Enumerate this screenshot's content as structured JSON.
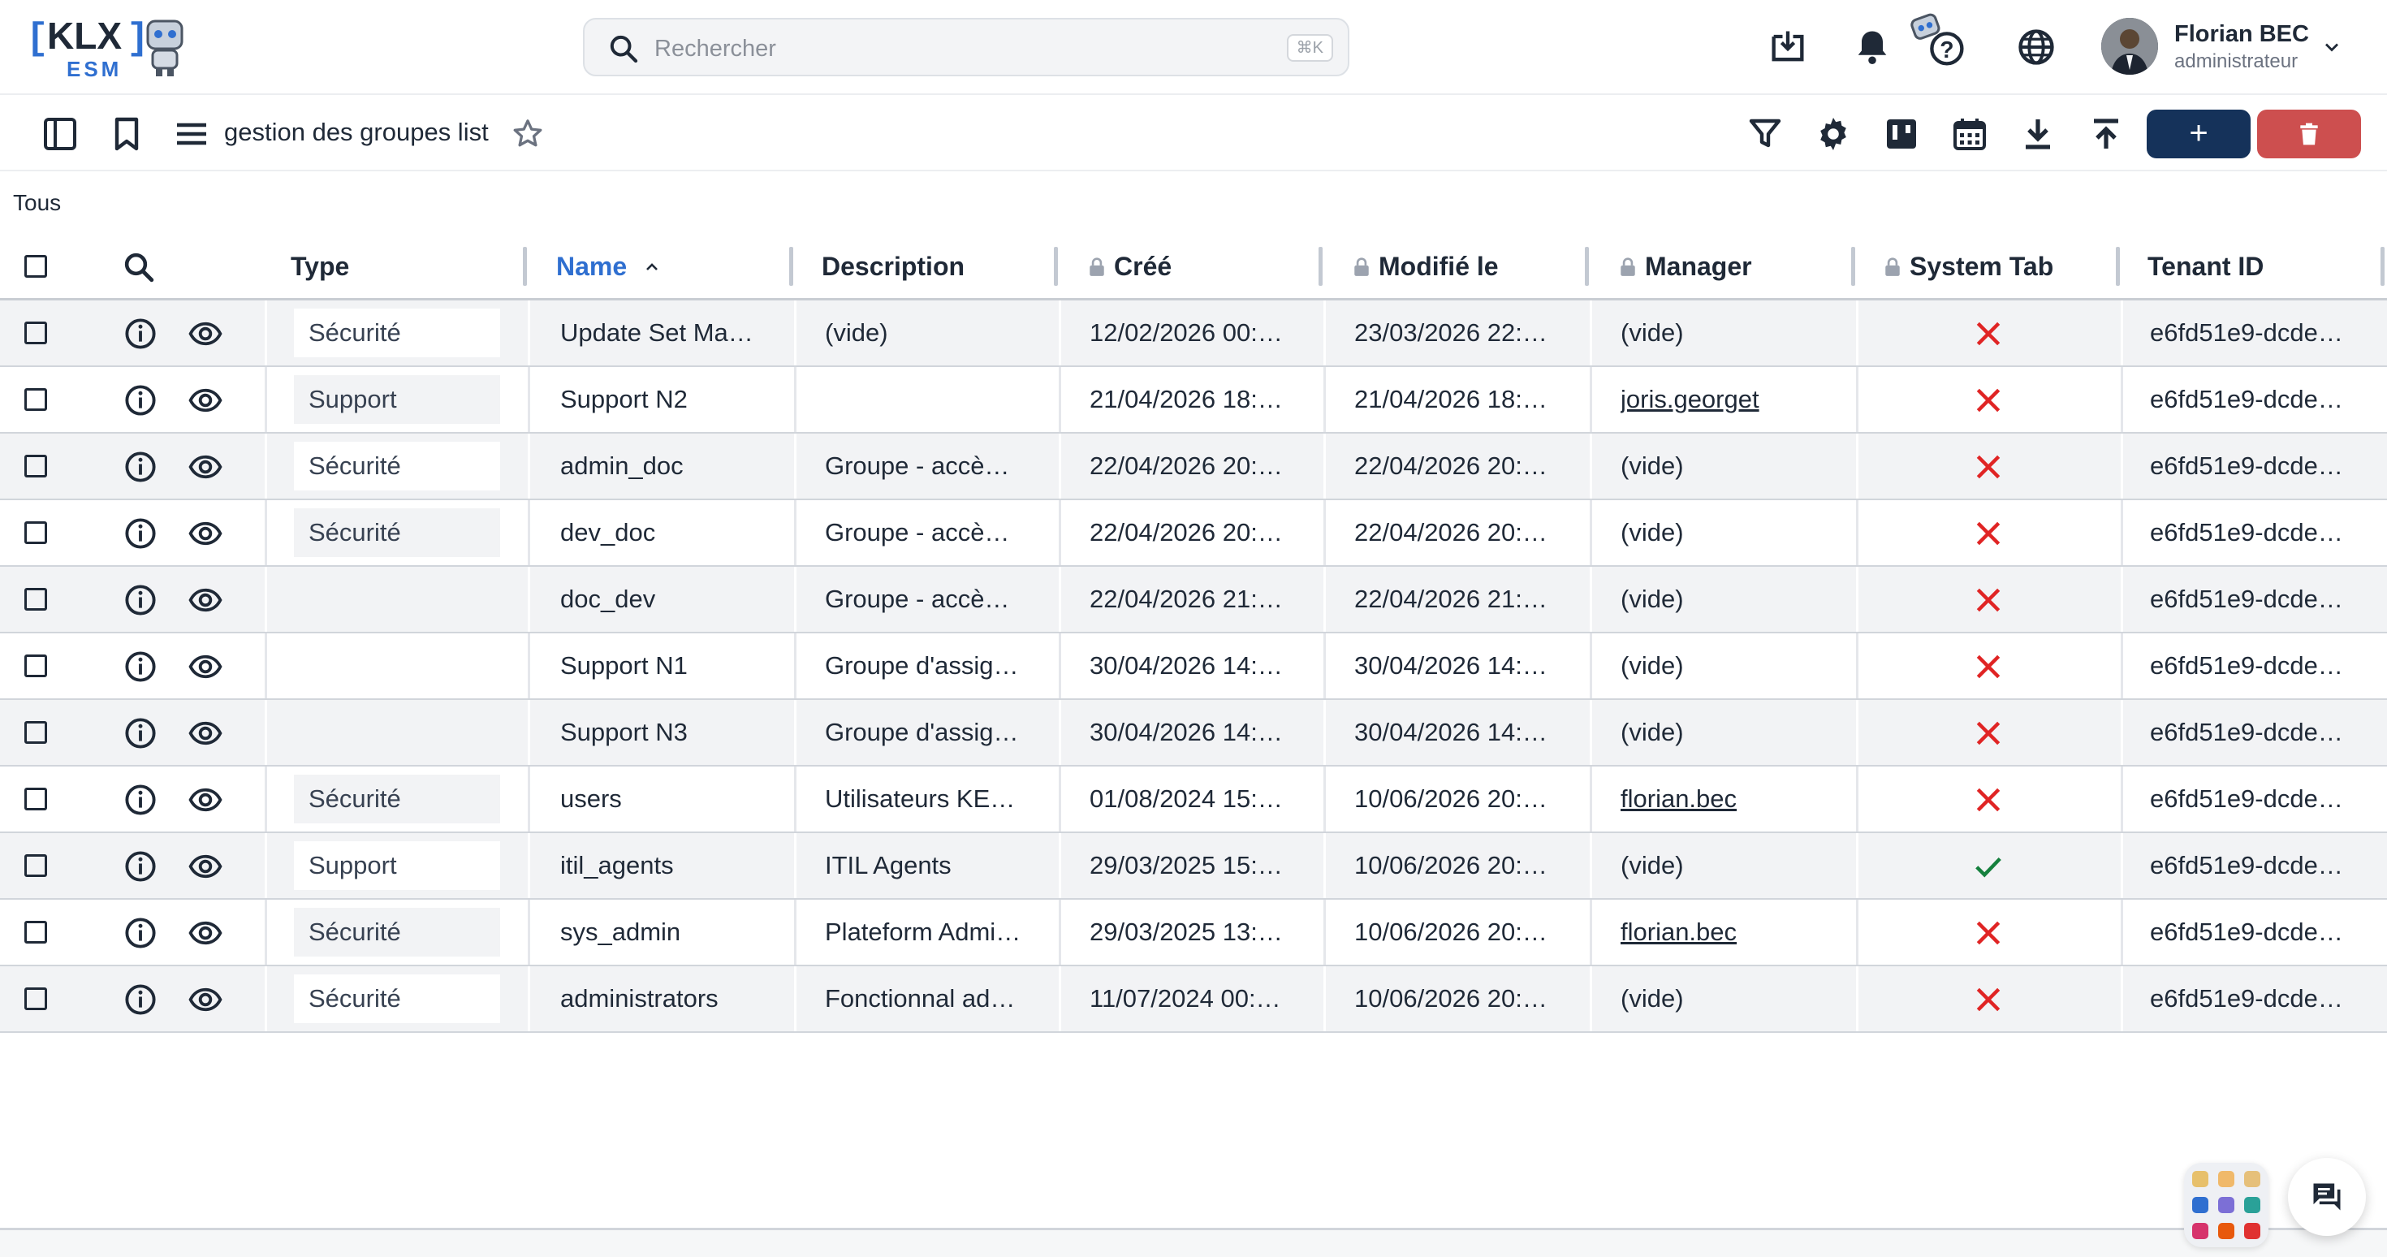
{
  "app": {
    "logo_text": "KLX",
    "logo_sub": "ESM"
  },
  "search": {
    "placeholder": "Rechercher",
    "shortcut": "⌘K"
  },
  "user": {
    "name": "Florian BEC",
    "role": "administrateur"
  },
  "toolbar": {
    "title": "gestion des groupes list",
    "add_label": "+"
  },
  "scope": "Tous",
  "columns": [
    {
      "label": "Type",
      "locked": false,
      "sorted": false
    },
    {
      "label": "Name",
      "locked": false,
      "sorted": true,
      "sort_dir": "asc"
    },
    {
      "label": "Description",
      "locked": false,
      "sorted": false
    },
    {
      "label": "Créé",
      "locked": true,
      "sorted": false
    },
    {
      "label": "Modifié le",
      "locked": true,
      "sorted": false
    },
    {
      "label": "Manager",
      "locked": true,
      "sorted": false
    },
    {
      "label": "System Tab",
      "locked": true,
      "sorted": false
    },
    {
      "label": "Tenant ID",
      "locked": false,
      "sorted": false
    }
  ],
  "rows": [
    {
      "type": "Sécurité",
      "name": "Update Set Ma…",
      "description": "(vide)",
      "created": "12/02/2026 00:…",
      "modified": "23/03/2026 22:…",
      "manager": "(vide)",
      "manager_link": false,
      "system": false,
      "tenant": "e6fd51e9-dcde…"
    },
    {
      "type": "Support",
      "name": "Support N2",
      "description": "",
      "created": "21/04/2026 18:…",
      "modified": "21/04/2026 18:…",
      "manager": "joris.georget",
      "manager_link": true,
      "system": false,
      "tenant": "e6fd51e9-dcde…"
    },
    {
      "type": "Sécurité",
      "name": "admin_doc",
      "description": "Groupe - accè…",
      "created": "22/04/2026 20:…",
      "modified": "22/04/2026 20:…",
      "manager": "(vide)",
      "manager_link": false,
      "system": false,
      "tenant": "e6fd51e9-dcde…"
    },
    {
      "type": "Sécurité",
      "name": "dev_doc",
      "description": "Groupe - accè…",
      "created": "22/04/2026 20:…",
      "modified": "22/04/2026 20:…",
      "manager": "(vide)",
      "manager_link": false,
      "system": false,
      "tenant": "e6fd51e9-dcde…"
    },
    {
      "type": "",
      "name": "doc_dev",
      "description": "Groupe - accè…",
      "created": "22/04/2026 21:…",
      "modified": "22/04/2026 21:…",
      "manager": "(vide)",
      "manager_link": false,
      "system": false,
      "tenant": "e6fd51e9-dcde…"
    },
    {
      "type": "",
      "name": "Support N1",
      "description": "Groupe d'assig…",
      "created": "30/04/2026 14:…",
      "modified": "30/04/2026 14:…",
      "manager": "(vide)",
      "manager_link": false,
      "system": false,
      "tenant": "e6fd51e9-dcde…"
    },
    {
      "type": "",
      "name": "Support N3",
      "description": "Groupe d'assig…",
      "created": "30/04/2026 14:…",
      "modified": "30/04/2026 14:…",
      "manager": "(vide)",
      "manager_link": false,
      "system": false,
      "tenant": "e6fd51e9-dcde…"
    },
    {
      "type": "Sécurité",
      "name": "users",
      "description": "Utilisateurs KE…",
      "created": "01/08/2024 15:…",
      "modified": "10/06/2026 20:…",
      "manager": "florian.bec",
      "manager_link": true,
      "system": false,
      "tenant": "e6fd51e9-dcde…"
    },
    {
      "type": "Support",
      "name": "itil_agents",
      "description": "ITIL Agents",
      "created": "29/03/2025 15:…",
      "modified": "10/06/2026 20:…",
      "manager": "(vide)",
      "manager_link": false,
      "system": true,
      "tenant": "e6fd51e9-dcde…"
    },
    {
      "type": "Sécurité",
      "name": "sys_admin",
      "description": "Plateform Admi…",
      "created": "29/03/2025 13:…",
      "modified": "10/06/2026 20:…",
      "manager": "florian.bec",
      "manager_link": true,
      "system": false,
      "tenant": "e6fd51e9-dcde…"
    },
    {
      "type": "Sécurité",
      "name": "administrators",
      "description": "Fonctionnal ad…",
      "created": "11/07/2024 00:…",
      "modified": "10/06/2026 20:…",
      "manager": "(vide)",
      "manager_link": false,
      "system": false,
      "tenant": "e6fd51e9-dcde…"
    }
  ],
  "colors": {
    "accent": "#15325a",
    "danger": "#cd4f4f",
    "sorted_header": "#2f6fd0",
    "false_mark": "#e02424",
    "true_mark": "#15803d",
    "logo_blue": "#2f6fd0"
  },
  "icons": [
    "search-icon",
    "install-app-icon",
    "bell-icon",
    "help-bot-icon",
    "globe-icon",
    "chevron-down-icon",
    "sidebar-toggle-icon",
    "bookmark-icon",
    "menu-icon",
    "star-icon",
    "filter-icon",
    "gear-icon",
    "kanban-icon",
    "calendar-icon",
    "download-icon",
    "upload-icon",
    "trash-icon",
    "chat-icon",
    "apps-grid-icon",
    "info-icon",
    "eye-icon",
    "lock-icon",
    "close-icon",
    "check-icon"
  ]
}
